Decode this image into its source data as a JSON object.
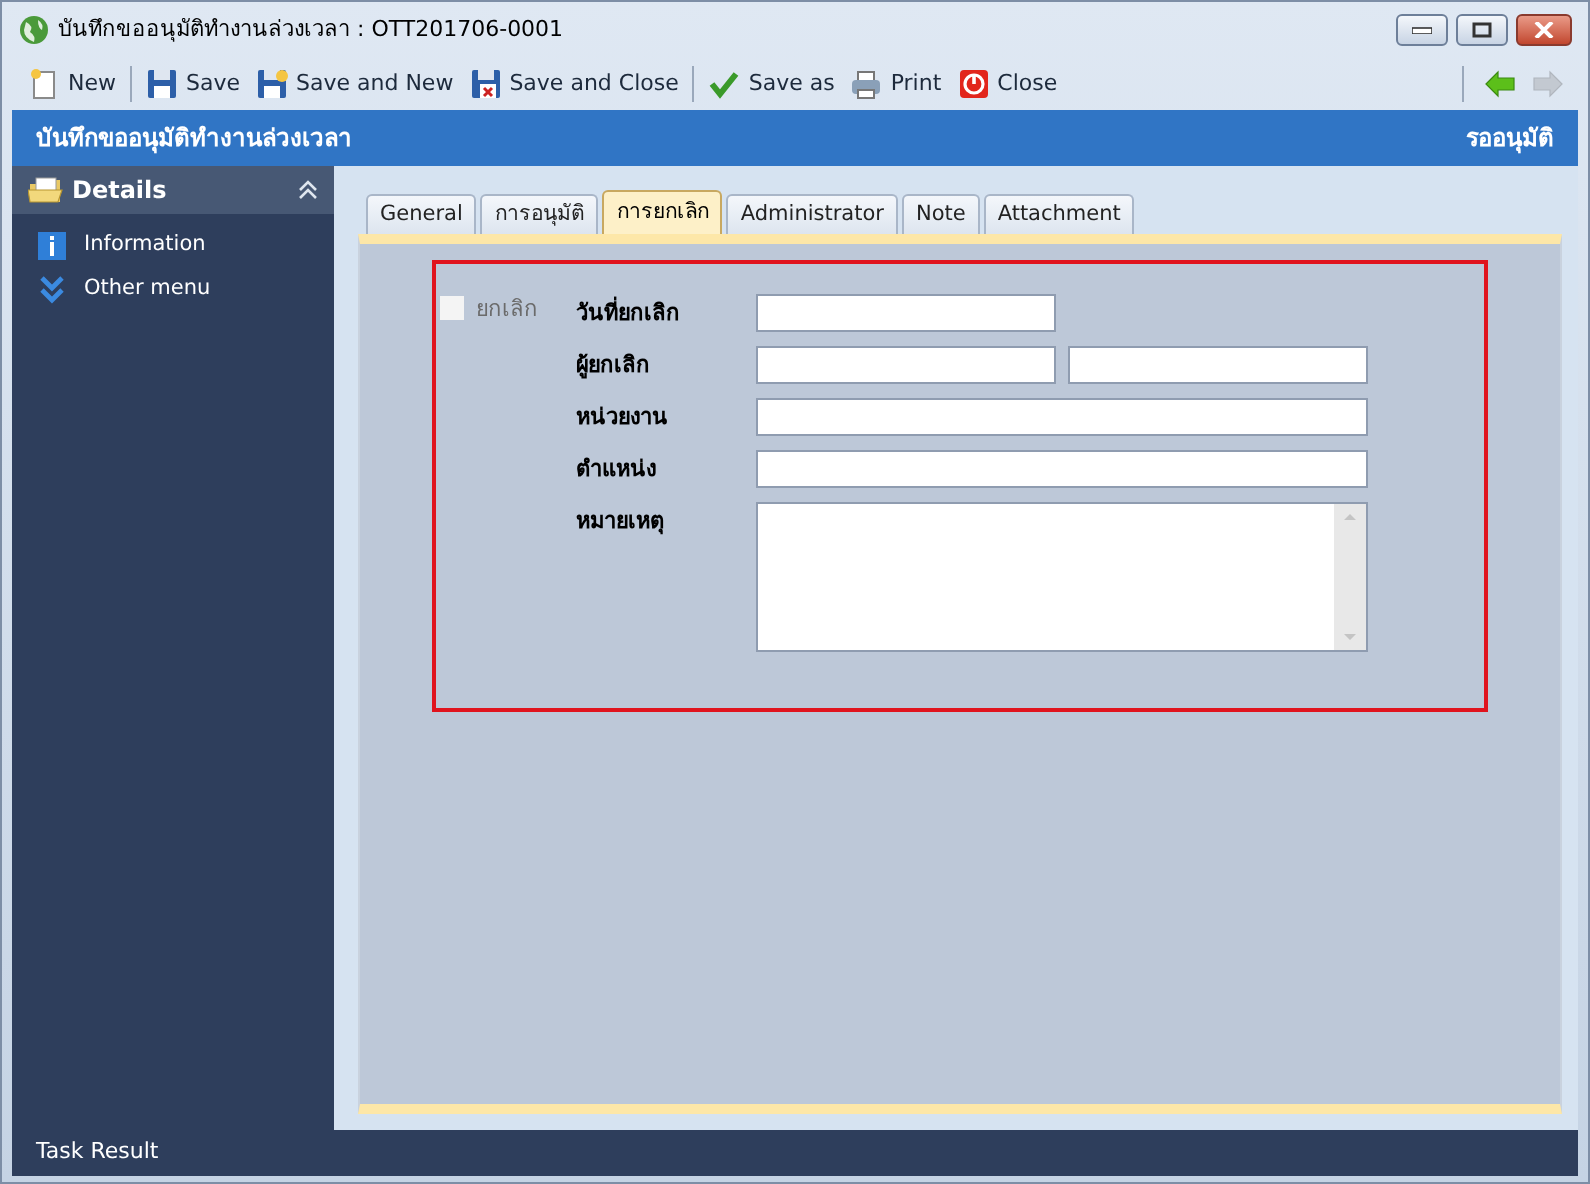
{
  "window": {
    "title": "บันทึกขออนุมัติทำงานล่วงเวลา : OTT201706-0001"
  },
  "toolbar": [
    {
      "label": "New",
      "separator_after": true
    },
    {
      "label": "Save",
      "separator_after": false
    },
    {
      "label": "Save and New",
      "separator_after": false
    },
    {
      "label": "Save and Close",
      "separator_after": true
    },
    {
      "label": "Save as",
      "separator_after": false
    },
    {
      "label": "Print",
      "separator_after": false
    },
    {
      "label": "Close",
      "separator_after": false
    }
  ],
  "nav": [
    {
      "disabled": false
    },
    {
      "disabled": true
    }
  ],
  "header": {
    "title": "บันทึกขออนุมัติทำงานล่วงเวลา",
    "status": "รออนุมัติ"
  },
  "sidebar": {
    "title": "Details",
    "expanded": true,
    "items": [
      {
        "label": "Information"
      },
      {
        "label": "Other menu"
      }
    ]
  },
  "tabs": [
    {
      "label": "General",
      "selected": false
    },
    {
      "label": "การอนุมัติ",
      "selected": false
    },
    {
      "label": "การยกเลิก",
      "selected": true
    },
    {
      "label": "Administrator",
      "selected": false
    },
    {
      "label": "Note",
      "selected": false
    },
    {
      "label": "Attachment",
      "selected": false
    }
  ],
  "cancel_checkbox": {
    "label": "ยกเลิก",
    "checked": false,
    "disabled": true
  },
  "fields": [
    {
      "label": "วันที่ยกเลิก",
      "kind": "short"
    },
    {
      "label": "ผู้ยกเลิก",
      "kind": "pair"
    },
    {
      "label": "หน่วยงาน",
      "kind": "wide"
    },
    {
      "label": "ตำแหน่ง",
      "kind": "wide"
    },
    {
      "label": "หมายเหตุ",
      "kind": "multiline"
    }
  ],
  "status_bar": {
    "text": "Task Result"
  }
}
